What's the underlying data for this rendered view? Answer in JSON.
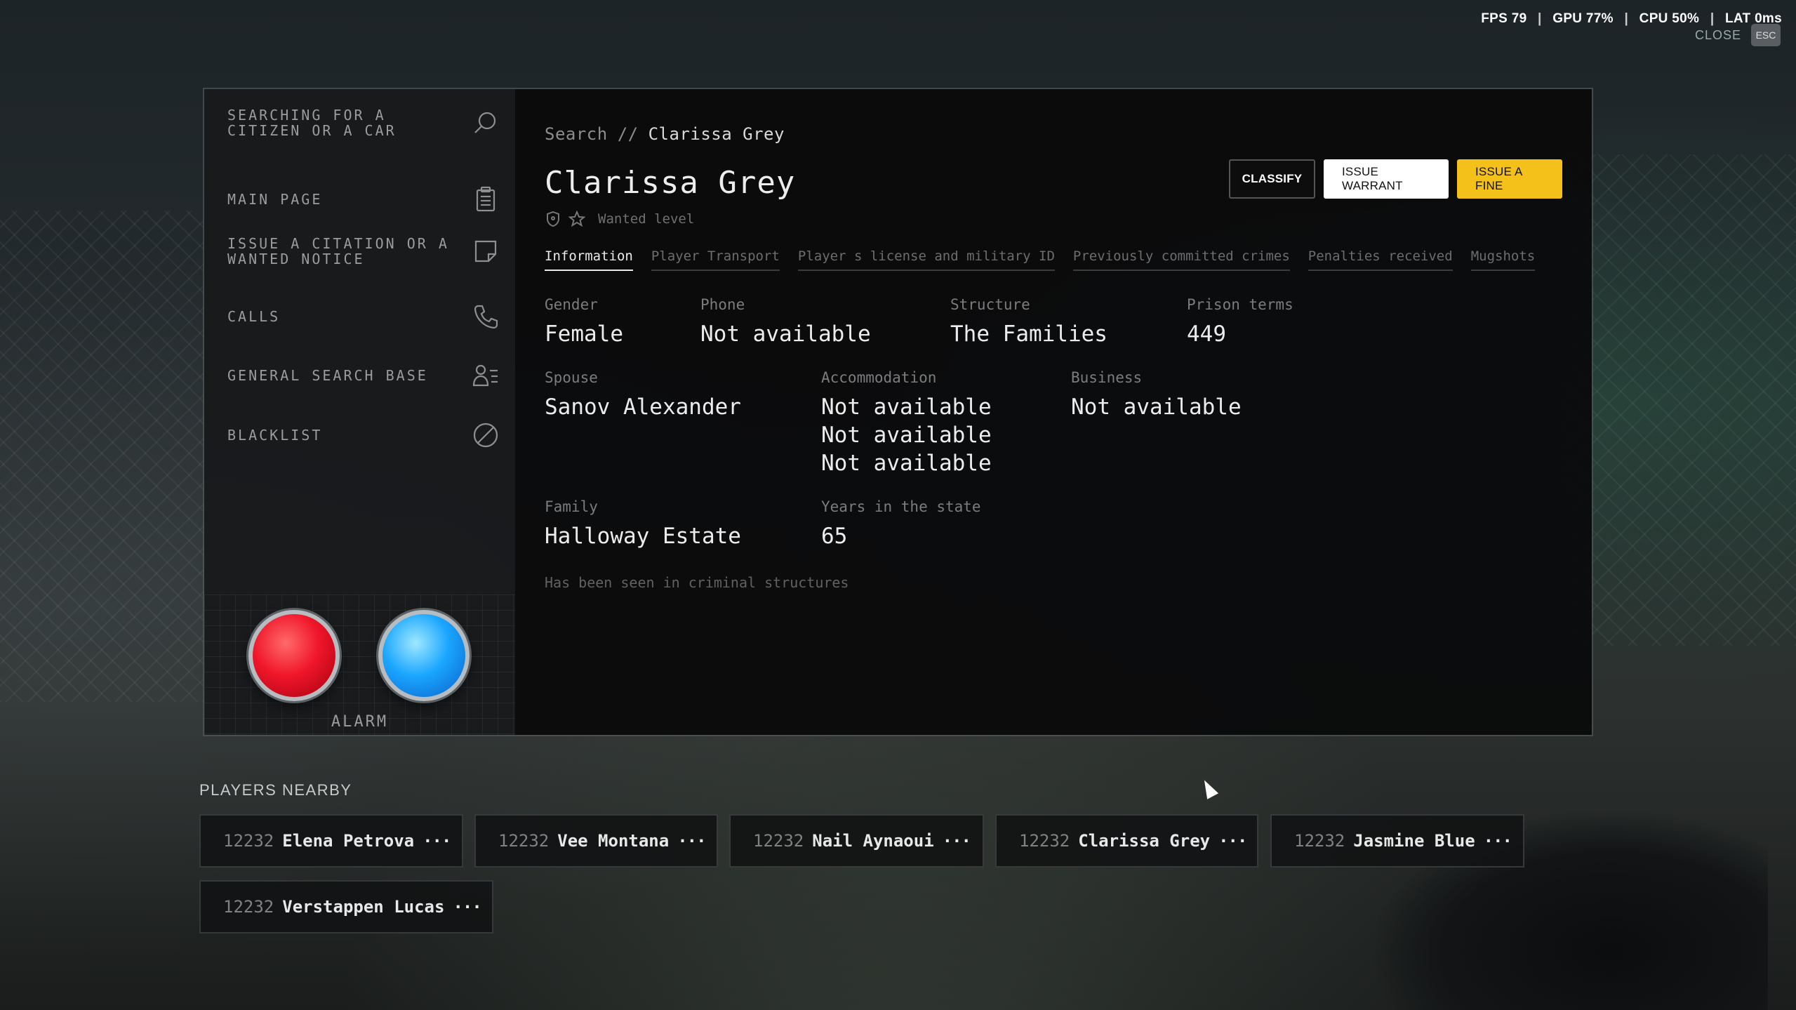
{
  "hud": {
    "fps_label": "FPS",
    "fps_value": "79",
    "gpu_label": "GPU",
    "gpu_value": "77%",
    "cpu_label": "CPU",
    "cpu_value": "50%",
    "lat_label": "LAT",
    "lat_value": "0ms",
    "close_label": "CLOSE",
    "esc_label": "ESC"
  },
  "sidebar": {
    "items": [
      {
        "label": "SEARCHING FOR A CITIZEN OR A CAR",
        "icon": "search-icon"
      },
      {
        "label": "MAIN PAGE",
        "icon": "clipboard-icon"
      },
      {
        "label": "ISSUE A CITATION OR A WANTED NOTICE",
        "icon": "note-icon"
      },
      {
        "label": "CALLS",
        "icon": "phone-icon"
      },
      {
        "label": "GENERAL SEARCH BASE",
        "icon": "user-list-icon"
      },
      {
        "label": "BLACKLIST",
        "icon": "blocked-icon"
      }
    ],
    "alarm_label": "ALARM"
  },
  "breadcrumb": {
    "root": "Search",
    "separator": "//",
    "current": "Clarissa Grey"
  },
  "person": {
    "name": "Clarissa Grey",
    "wanted_label": "Wanted level"
  },
  "actions": {
    "classify": "CLASSIFY",
    "warrant": "ISSUE WARRANT",
    "fine": "ISSUE A FINE"
  },
  "tabs": [
    {
      "label": "Information"
    },
    {
      "label": "Player Transport"
    },
    {
      "label": "Player s license and military ID"
    },
    {
      "label": "Previously committed crimes"
    },
    {
      "label": "Penalties received"
    },
    {
      "label": "Mugshots"
    }
  ],
  "info": {
    "gender": {
      "label": "Gender",
      "value": "Female"
    },
    "phone": {
      "label": "Phone",
      "value": "Not available"
    },
    "structure": {
      "label": "Structure",
      "value": "The Families"
    },
    "prison": {
      "label": "Prison terms",
      "value": "449"
    },
    "spouse": {
      "label": "Spouse",
      "value": "Sanov Alexander"
    },
    "accommodation": {
      "label": "Accommodation",
      "values": [
        "Not available",
        "Not available",
        "Not available"
      ]
    },
    "business": {
      "label": "Business",
      "value": "Not available"
    },
    "family": {
      "label": "Family",
      "value": "Halloway Estate"
    },
    "years": {
      "label": "Years in the state",
      "value": "65"
    },
    "seen_note": "Has been seen in criminal structures"
  },
  "nearby": {
    "title": "PLAYERS NEARBY",
    "players": [
      {
        "id": "12232",
        "name": "Elena Petrova"
      },
      {
        "id": "12232",
        "name": "Vee Montana"
      },
      {
        "id": "12232",
        "name": "Nail Aynaoui"
      },
      {
        "id": "12232",
        "name": "Clarissa Grey"
      },
      {
        "id": "12232",
        "name": "Jasmine Blue"
      },
      {
        "id": "12232",
        "name": "Verstappen Lucas"
      }
    ],
    "more_glyph": "···"
  },
  "colors": {
    "accent": "#f3c11a",
    "alarm_red": "#f0162a",
    "alarm_blue": "#1aa6ff"
  }
}
